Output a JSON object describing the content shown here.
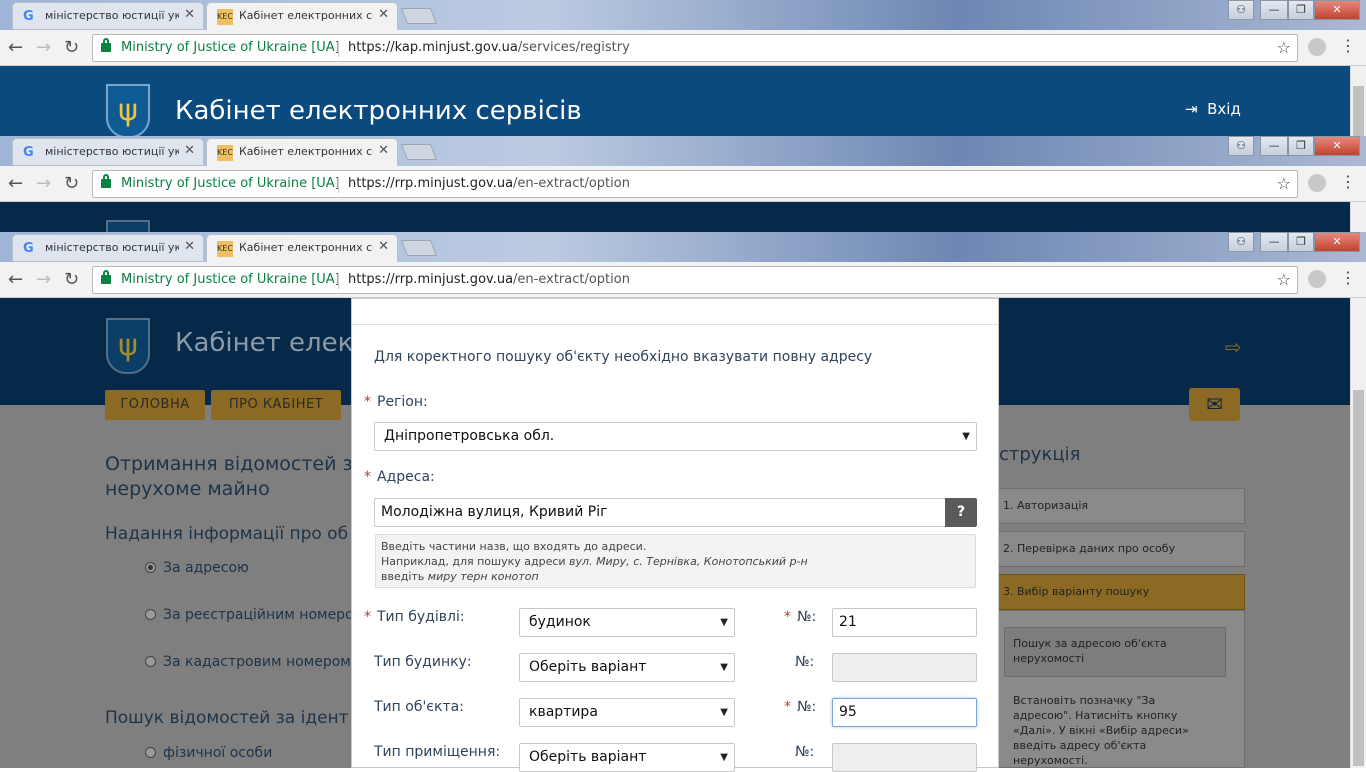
{
  "browser": {
    "tabs": [
      {
        "label": "міністерство юстиції укр"
      },
      {
        "label": "Кабінет електронних се"
      }
    ],
    "favicon_active": "KEC",
    "site_name": "Ministry of Justice of Ukraine [UA]",
    "url_layer1": {
      "host": "https://kap.minjust.gov.ua",
      "path": "/services/registry"
    },
    "url_layer2": {
      "host": "https://rrp.minjust.gov.ua",
      "path": "/en-extract/option"
    },
    "url_layer3": {
      "host": "https://rrp.minjust.gov.ua",
      "path": "/en-extract/option"
    }
  },
  "site": {
    "title": "Кабінет електронних сервісів",
    "title_short": "Кабінет елект",
    "login": "Вхід",
    "nav": [
      "ГОЛОВНА",
      "ПРО КАБІНЕТ"
    ]
  },
  "page": {
    "heading_line1": "Отримання відомостей з",
    "heading_line2": "нерухоме майно",
    "subheading": "Надання інформації про об",
    "options": [
      "За адресою",
      "За реєстраційним номером",
      "За кадастровим номером з"
    ],
    "search_heading": "Пошук відомостей за ідент",
    "person_option": "фізичної особи",
    "instruction_title": "струкція",
    "steps": [
      "1. Авторизація",
      "2. Перевірка даних про особу",
      "3. Вибір варіанту пошуку"
    ],
    "step_panel_title": "Пошук за адресою об'єкта нерухомості",
    "step_panel_text": "Встановіть позначку \"За адресою\". Натисніть кнопку «Далі». У вікні «Вибір адреси» введіть адресу об'єкта нерухомості."
  },
  "modal": {
    "intro": "Для коректного пошуку об'єкту необхідно вказувати повну адресу",
    "region_label": "Регіон:",
    "region_value": "Дніпропетровська обл.",
    "address_label": "Адреса:",
    "address_value": "Молодіжна вулиця, Кривий Ріг",
    "help_button": "?",
    "hint_line1": "Введіть частини назв, що входять до адреси.",
    "hint_line2_prefix": "Наприклад, для пошуку адреси ",
    "hint_line2_example": "вул. Миру, с. Тернівка, Конотопський р-н",
    "hint_line3_prefix": "введіть ",
    "hint_line3_example": "миру терн конотоп",
    "building_type_label": "Тип будівлі:",
    "building_type_value": "будинок",
    "number_label": "№:",
    "building_number": "21",
    "house_type_label": "Тип будинку:",
    "house_type_value": "Оберіть варіант",
    "object_type_label": "Тип об'єкта:",
    "object_type_value": "квартира",
    "object_number": "95",
    "room_type_label": "Тип приміщення:",
    "room_type_value": "Оберіть варіант"
  },
  "colors": {
    "header": "#0b4a7e",
    "accent_gold": "#e6b34a",
    "required": "#c0392b",
    "secure": "#0b8043"
  }
}
